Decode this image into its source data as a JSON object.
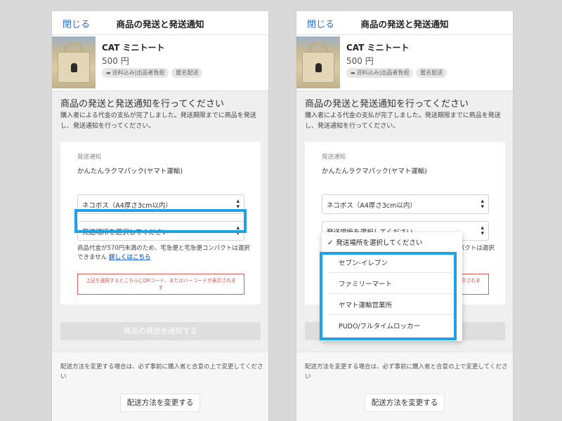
{
  "header": {
    "close_label": "閉じる",
    "title": "商品の発送と発送通知"
  },
  "product": {
    "name": "CAT ミニトート",
    "price": "500 円",
    "chip_shipping_icon": "truck-icon",
    "chip_shipping": "送料込み|出品者負担",
    "chip_anonymous": "匿名配送"
  },
  "main": {
    "heading": "商品の発送と発送通知を行ってください",
    "description": "購入者による代金の支払が完了しました。発送期限までに商品を発送し、発送通知を行ってください。"
  },
  "card": {
    "section_label": "発送通知",
    "method": "かんたんラクマパック(ヤマト運輸)",
    "size_select": "ネコポス（A4厚さ3cm以内）",
    "location_select": "発送場所を選択してください",
    "note_text": "商品代金が570円未満のため、宅急便と宅急便コンパクトは選択できません ",
    "note_link": "詳しくはこちら",
    "warning": "上記を選択するとこちらにQRコード、またはバーコードが表示されます"
  },
  "buttons": {
    "notify": "商品の発送を通知する",
    "change_method": "配送方法を変更する"
  },
  "footer": {
    "note": "配送方法を変更する場合は、必ず事前に購入者と合意の上で変更してください"
  },
  "dropdown": {
    "check": "✓",
    "selected": "発送場所を選択してください",
    "options": [
      "セブン-イレブン",
      "ファミリーマート",
      "ヤマト運輸営業所",
      "PUDO/フルタイムロッカー"
    ]
  },
  "colors": {
    "highlight": "#1ea2e6",
    "link": "#2f6fd6",
    "warning": "#e24b4b"
  }
}
